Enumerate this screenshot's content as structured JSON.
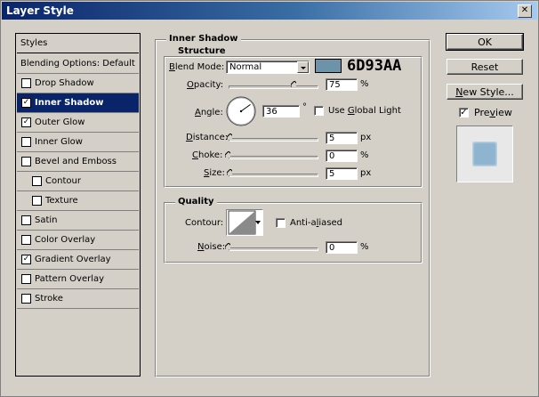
{
  "window": {
    "title": "Layer Style",
    "close_glyph": "✕"
  },
  "styles_list": {
    "header": "Styles",
    "items": [
      {
        "label": "Blending Options: Default",
        "checkbox": false,
        "checked": false
      },
      {
        "label": "Drop Shadow",
        "checkbox": true,
        "checked": false
      },
      {
        "label": "Inner Shadow",
        "checkbox": true,
        "checked": true,
        "selected": true
      },
      {
        "label": "Outer Glow",
        "checkbox": true,
        "checked": true
      },
      {
        "label": "Inner Glow",
        "checkbox": true,
        "checked": false
      },
      {
        "label": "Bevel and Emboss",
        "checkbox": true,
        "checked": false
      },
      {
        "label": "Contour",
        "checkbox": true,
        "checked": false,
        "indent": true
      },
      {
        "label": "Texture",
        "checkbox": true,
        "checked": false,
        "indent": true
      },
      {
        "label": "Satin",
        "checkbox": true,
        "checked": false
      },
      {
        "label": "Color Overlay",
        "checkbox": true,
        "checked": false
      },
      {
        "label": "Gradient Overlay",
        "checkbox": true,
        "checked": true
      },
      {
        "label": "Pattern Overlay",
        "checkbox": true,
        "checked": false
      },
      {
        "label": "Stroke",
        "checkbox": true,
        "checked": false
      }
    ]
  },
  "inner_shadow": {
    "title": "Inner Shadow",
    "structure": {
      "title": "Structure",
      "blend_mode": {
        "label_u": "B",
        "label_rest": "lend Mode:",
        "value": "Normal"
      },
      "swatch_color": "#6D93AA",
      "color_hex_text": "6D93AA",
      "opacity": {
        "label_u": "O",
        "label_rest": "pacity:",
        "value": "75",
        "unit": "%",
        "fraction": 0.75
      },
      "angle": {
        "label_u": "A",
        "label_rest": "ngle:",
        "value": "36",
        "unit": "°",
        "degrees": 36
      },
      "global_light": {
        "label_pre": "Use ",
        "label_u": "G",
        "label_rest": "lobal Light",
        "checked": false
      },
      "distance": {
        "label_u": "D",
        "label_rest": "istance:",
        "value": "5",
        "unit": "px",
        "fraction": 0.02
      },
      "choke": {
        "label_u": "C",
        "label_rest": "hoke:",
        "value": "0",
        "unit": "%",
        "fraction": 0.0
      },
      "size": {
        "label_u": "S",
        "label_rest": "ize:",
        "value": "5",
        "unit": "px",
        "fraction": 0.02
      }
    },
    "quality": {
      "title": "Quality",
      "contour_label": "Contour:",
      "anti_aliased": {
        "label_pre": "Anti-a",
        "label_u": "l",
        "label_rest": "iased",
        "checked": false
      },
      "noise": {
        "label_u": "N",
        "label_rest": "oise:",
        "value": "0",
        "unit": "%",
        "fraction": 0.0
      }
    }
  },
  "buttons": {
    "ok": "OK",
    "reset": "Reset",
    "new_style": "New Style...",
    "preview": {
      "label": "Preview",
      "label_u": "v",
      "checked": true
    }
  },
  "colors": {
    "selection": "#0a246a",
    "preview_fill": "#8fb4cf",
    "swatch": "#6D93AA"
  }
}
